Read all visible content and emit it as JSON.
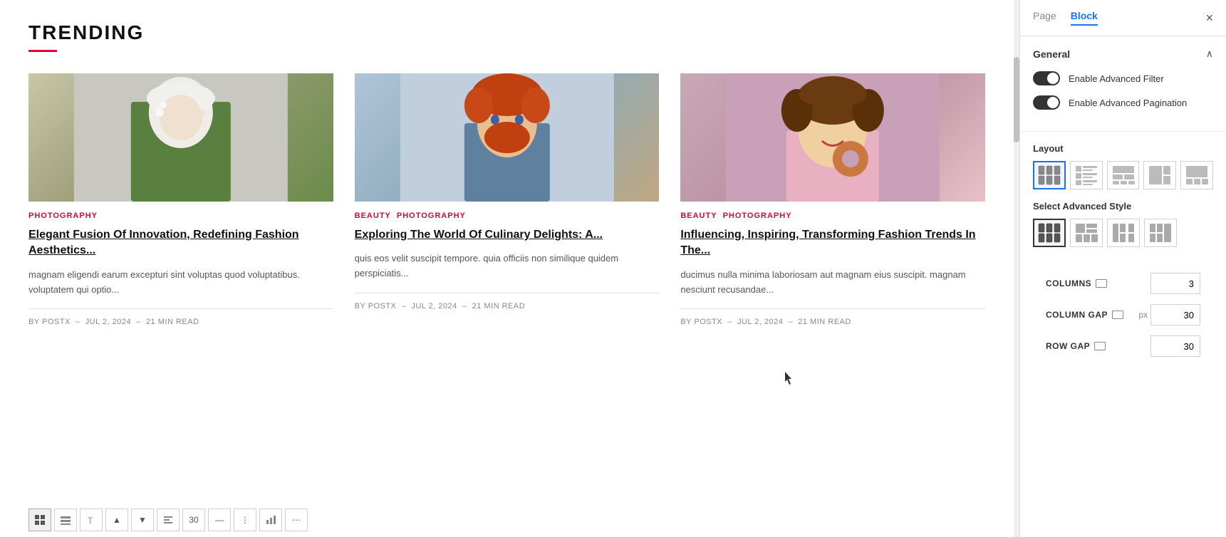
{
  "header": {
    "title": "TRENDING"
  },
  "posts": [
    {
      "id": 1,
      "categories": [
        "PHOTOGRAPHY"
      ],
      "title": "Elegant Fusion Of Innovation, Redefining Fashion Aesthetics...",
      "excerpt": "magnam eligendi earum excepturi sint voluptas quod voluptatibus. voluptatem qui optio...",
      "author": "BY  POSTX",
      "date": "JUL 2, 2024",
      "read_time": "21 MIN READ",
      "img_type": "woman"
    },
    {
      "id": 2,
      "categories": [
        "BEAUTY",
        "PHOTOGRAPHY"
      ],
      "title": "Exploring The World Of Culinary Delights: A...",
      "excerpt": "quis eos velit suscipit tempore. quia officiis non similique quidem perspiciatis...",
      "author": "BY  POSTX",
      "date": "JUL 2, 2024",
      "read_time": "21 MIN READ",
      "img_type": "man"
    },
    {
      "id": 3,
      "categories": [
        "BEAUTY",
        "PHOTOGRAPHY"
      ],
      "title": "Influencing, Inspiring, Transforming Fashion Trends In The...",
      "excerpt": "ducimus nulla minima laboriosam aut magnam eius suscipit. magnam nesciunt recusandae...",
      "author": "BY  POSTX",
      "date": "JUL 2, 2024",
      "read_time": "21 MIN READ",
      "img_type": "child"
    }
  ],
  "toolbar_buttons": [
    "grid1",
    "grid2",
    "text",
    "number",
    "div1",
    "div2",
    "chart",
    "bar",
    "dot",
    "more"
  ],
  "panel": {
    "tabs": [
      "Page",
      "Block"
    ],
    "active_tab": "Block",
    "close_label": "×",
    "general_section": {
      "title": "General",
      "toggle1_label": "Enable Advanced Filter",
      "toggle2_label": "Enable Advanced Pagination"
    },
    "layout_section": {
      "title": "Layout",
      "options_count": 5
    },
    "advanced_style_section": {
      "title": "Select Advanced Style",
      "options_count": 4
    },
    "fields": {
      "columns_label": "COLUMNS",
      "columns_value": "3",
      "column_gap_label": "COLUMN GAP",
      "column_gap_unit": "px",
      "column_gap_value": "30",
      "row_gap_label": "ROW GAP",
      "row_gap_value": "30"
    }
  }
}
